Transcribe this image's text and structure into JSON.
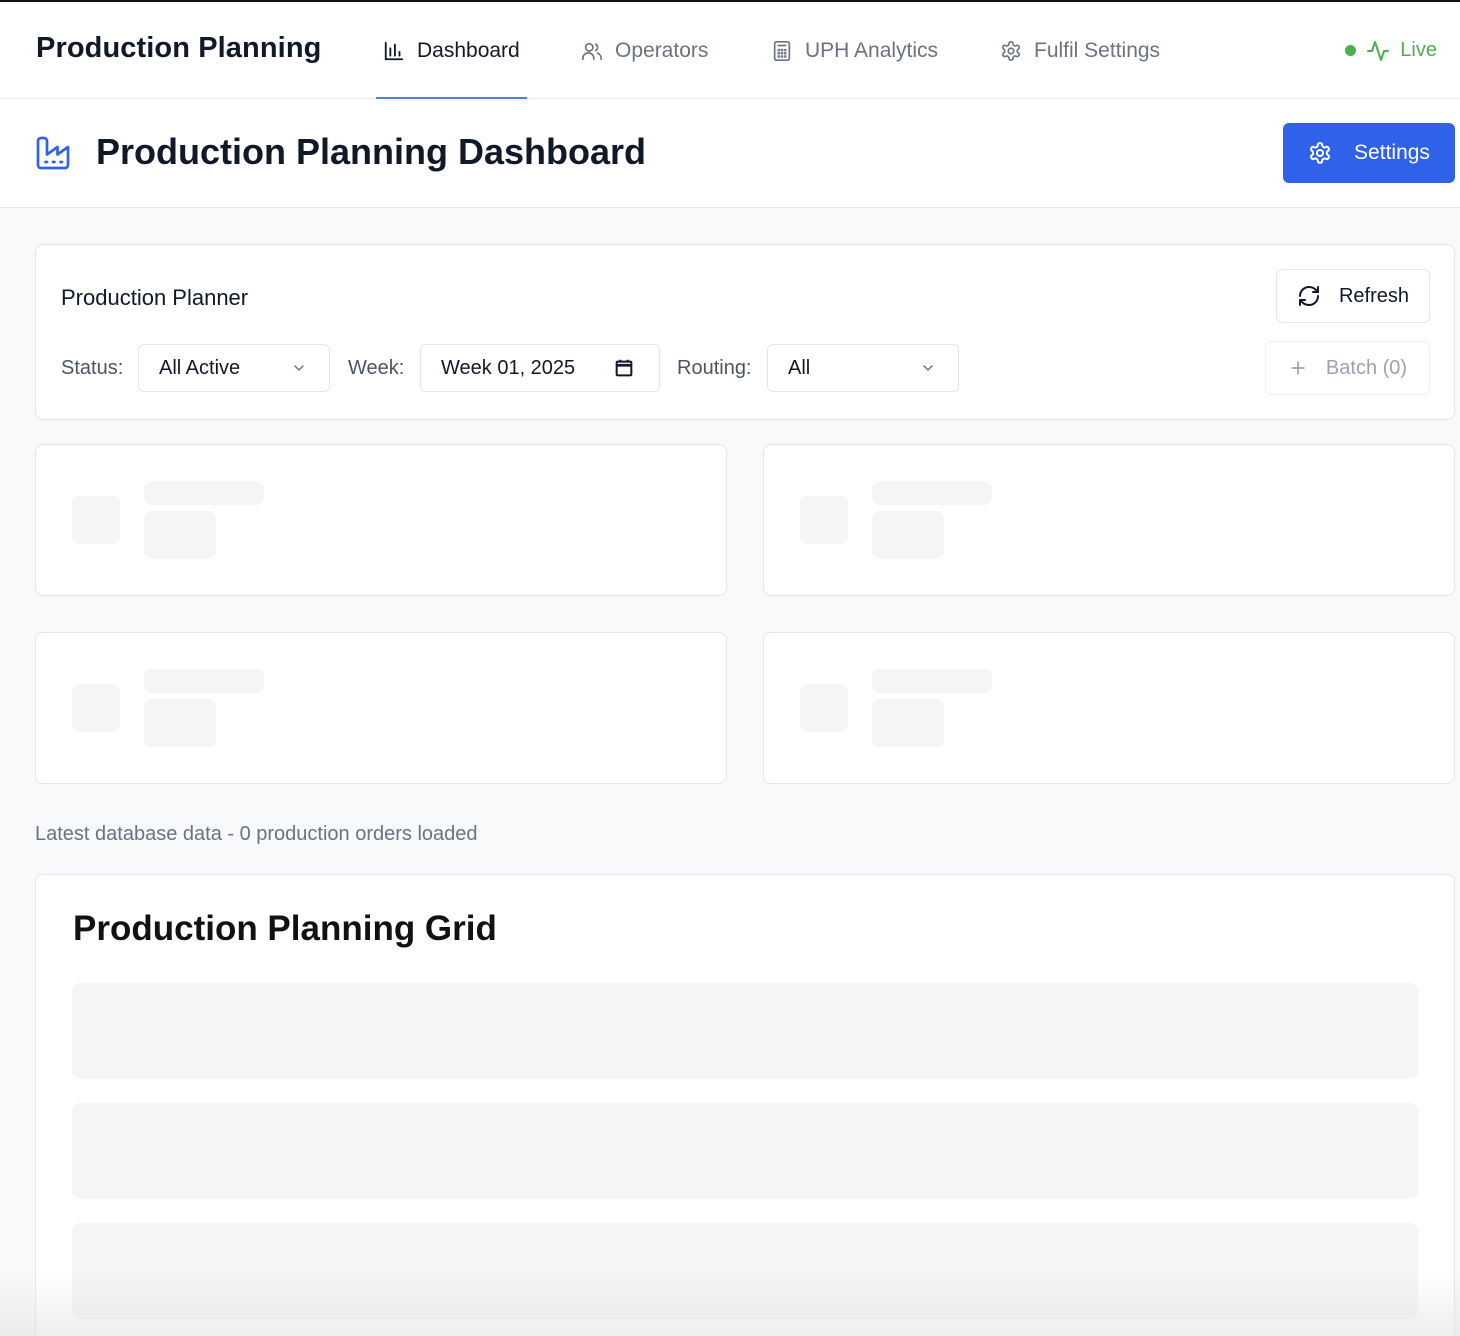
{
  "nav": {
    "brand": "Production Planning",
    "items": [
      {
        "label": "Dashboard",
        "icon": "bar-chart-icon",
        "active": true
      },
      {
        "label": "Operators",
        "icon": "users-icon",
        "active": false
      },
      {
        "label": "UPH Analytics",
        "icon": "calculator-icon",
        "active": false
      },
      {
        "label": "Fulfil Settings",
        "icon": "gear-icon",
        "active": false
      }
    ],
    "status": {
      "label": "Live",
      "color": "#4caf50"
    }
  },
  "header": {
    "title": "Production Planning Dashboard",
    "settings_label": "Settings",
    "accent": "#2f62e8"
  },
  "planner": {
    "title": "Production Planner",
    "refresh_label": "Refresh",
    "status_label": "Status:",
    "status_value": "All Active",
    "week_label": "Week:",
    "week_value": "Week 01, 2025",
    "routing_label": "Routing:",
    "routing_value": "All",
    "batch_label": "Batch (0)"
  },
  "summary": "Latest database data - 0 production orders loaded",
  "grid": {
    "title": "Production Planning Grid"
  }
}
